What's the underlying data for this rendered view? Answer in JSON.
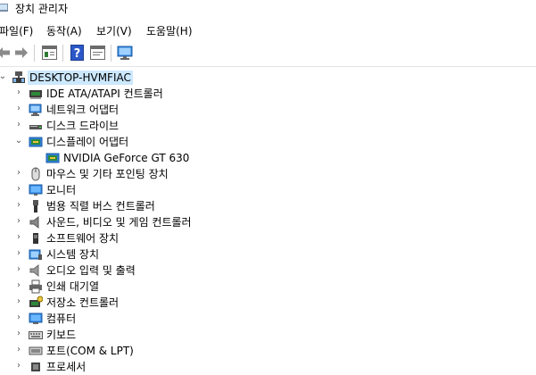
{
  "window": {
    "title": "장치 관리자"
  },
  "menu": [
    {
      "label": "파일(F)"
    },
    {
      "label": "동작(A)"
    },
    {
      "label": "보기(V)"
    },
    {
      "label": "도움말(H)"
    }
  ],
  "toolbar": {
    "buttons": [
      {
        "icon": "back-arrow-icon"
      },
      {
        "icon": "forward-arrow-icon"
      },
      {
        "icon": "properties-icon"
      },
      {
        "icon": "help-icon"
      },
      {
        "icon": "update-driver-icon"
      },
      {
        "icon": "scan-hardware-icon"
      }
    ]
  },
  "tree": {
    "root": {
      "label": "DESKTOP-HVMFIAC",
      "expanded": true
    },
    "items": [
      {
        "label": "IDE ATA/ATAPI 컨트롤러",
        "icon": "ide-controller-icon",
        "expanded": false
      },
      {
        "label": "네트워크 어댑터",
        "icon": "network-adapter-icon",
        "expanded": false
      },
      {
        "label": "디스크 드라이브",
        "icon": "disk-drive-icon",
        "expanded": false
      },
      {
        "label": "디스플레이 어댑터",
        "icon": "display-adapter-icon",
        "expanded": true,
        "children": [
          {
            "label": "NVIDIA GeForce GT 630",
            "icon": "display-adapter-icon"
          }
        ]
      },
      {
        "label": "마우스 및 기타 포인팅 장치",
        "icon": "mouse-icon",
        "expanded": false
      },
      {
        "label": "모니터",
        "icon": "monitor-icon",
        "expanded": false
      },
      {
        "label": "범용 직렬 버스 컨트롤러",
        "icon": "usb-icon",
        "expanded": false
      },
      {
        "label": "사운드, 비디오 및 게임 컨트롤러",
        "icon": "sound-icon",
        "expanded": false
      },
      {
        "label": "소프트웨어 장치",
        "icon": "software-device-icon",
        "expanded": false
      },
      {
        "label": "시스템 장치",
        "icon": "system-device-icon",
        "expanded": false
      },
      {
        "label": "오디오 입력 및 출력",
        "icon": "audio-icon",
        "expanded": false
      },
      {
        "label": "인쇄 대기열",
        "icon": "printer-icon",
        "expanded": false
      },
      {
        "label": "저장소 컨트롤러",
        "icon": "storage-controller-icon",
        "expanded": false
      },
      {
        "label": "컴퓨터",
        "icon": "computer-icon",
        "expanded": false
      },
      {
        "label": "키보드",
        "icon": "keyboard-icon",
        "expanded": false
      },
      {
        "label": "포트(COM & LPT)",
        "icon": "port-icon",
        "expanded": false
      },
      {
        "label": "프로세서",
        "icon": "processor-icon",
        "expanded": false
      }
    ]
  }
}
